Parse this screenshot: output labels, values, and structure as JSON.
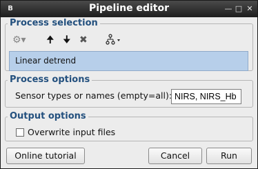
{
  "window": {
    "title": "Pipeline editor",
    "app_icon": "brainstorm-logo-icon"
  },
  "process_selection": {
    "title": "Process selection",
    "toolbar": [
      "gear-dropdown",
      "move-up-arrow",
      "move-down-arrow",
      "delete-x",
      "pipeline-tree-dropdown"
    ],
    "items": [
      "Linear detrend"
    ]
  },
  "process_options": {
    "title": "Process options",
    "sensor_label": "Sensor types or names (empty=all):",
    "sensor_value": "NIRS, NIRS_Hb"
  },
  "output_options": {
    "title": "Output options",
    "overwrite_label": "Overwrite input files",
    "overwrite_checked": false
  },
  "buttons": {
    "tutorial": "Online tutorial",
    "cancel": "Cancel",
    "run": "Run"
  }
}
